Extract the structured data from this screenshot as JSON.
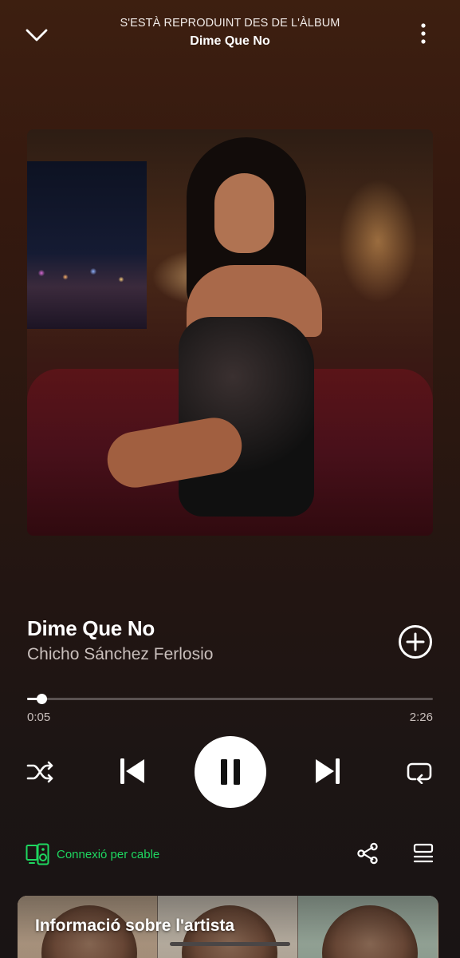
{
  "header": {
    "context": "S'ESTÀ REPRODUINT DES DE L'ÀLBUM",
    "album": "Dime Que No"
  },
  "track": {
    "title": "Dime Que No",
    "artist": "Chicho Sánchez Ferlosio"
  },
  "progress": {
    "elapsed": "0:05",
    "total": "2:26",
    "fraction": 0.035
  },
  "device": {
    "label": "Connexió per cable"
  },
  "artist_card": {
    "title": "Informació sobre l'artista"
  },
  "colors": {
    "accent": "#1ed760",
    "background_top": "#3d1f10",
    "background_bottom": "#191414"
  },
  "icons": {
    "collapse": "chevron-down-icon",
    "more": "more-vertical-icon",
    "add": "add-circle-icon",
    "shuffle": "shuffle-icon",
    "previous": "skip-previous-icon",
    "pause": "pause-icon",
    "next": "skip-next-icon",
    "repeat": "repeat-icon",
    "device": "speaker-device-icon",
    "share": "share-icon",
    "queue": "queue-icon"
  }
}
